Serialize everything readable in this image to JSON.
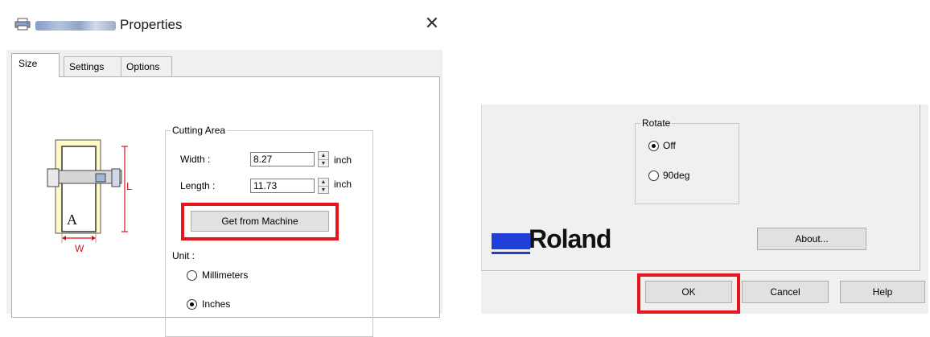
{
  "left_dialog": {
    "title": "Properties",
    "close_glyph": "✕",
    "tabs": [
      {
        "label": "Size",
        "active": true
      },
      {
        "label": "Settings",
        "active": false
      },
      {
        "label": "Options",
        "active": false
      }
    ],
    "illustration": {
      "length_label": "L",
      "width_label": "W",
      "letter": "A"
    },
    "cutting_area": {
      "legend": "Cutting Area",
      "width_label": "Width :",
      "width_value": "8.27",
      "width_unit": "inch",
      "length_label": "Length :",
      "length_value": "11.73",
      "length_unit": "inch",
      "get_button": "Get from Machine",
      "unit_label": "Unit :",
      "unit_options": [
        {
          "label": "Millimeters",
          "selected": false
        },
        {
          "label": "Inches",
          "selected": true
        }
      ]
    },
    "icons": {
      "title": "printer-icon"
    }
  },
  "right_panel": {
    "rotate": {
      "legend": "Rotate",
      "options": [
        {
          "label": "Off",
          "selected": true
        },
        {
          "label": "90deg",
          "selected": false
        }
      ]
    },
    "brand": "Roland",
    "about_button": "About...",
    "ok_button": "OK",
    "cancel_button": "Cancel",
    "help_button": "Help"
  },
  "colors": {
    "highlight": "#e8141c",
    "brand_blue": "#1f3eda",
    "dialog_bg": "#f0f0f0"
  }
}
